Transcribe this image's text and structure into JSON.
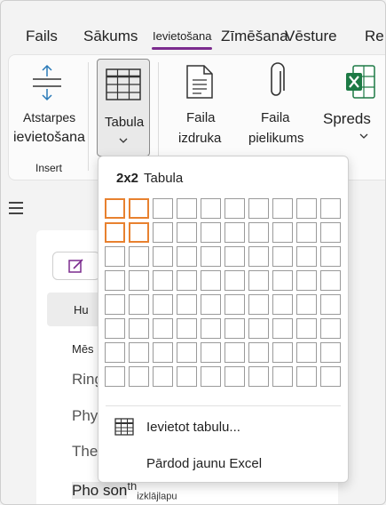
{
  "tabs": [
    {
      "label": "Fails"
    },
    {
      "label": "Sākums"
    },
    {
      "label": "Ievietošana"
    },
    {
      "label": "Zīmēšana"
    },
    {
      "label": "Vēsture"
    },
    {
      "label": "Re"
    }
  ],
  "ribbon": {
    "spacing": {
      "line1": "Atstarpes",
      "line2": "ievietošana"
    },
    "group_label": "Insert",
    "table": {
      "label": "Tabula"
    },
    "printout": {
      "line1": "Faila",
      "line2": "izdruka"
    },
    "attachment": {
      "line1": "Faila",
      "line2": "pielikums"
    },
    "spreadsheet": {
      "label": "Spreds"
    }
  },
  "left_pane": {
    "selected_row": "Hu",
    "items": [
      "Mēs",
      "Ring",
      "Phy",
      "The"
    ],
    "bottom_text": "Pho son",
    "bottom_sup": "th",
    "bottom_sub": "izklājlapu"
  },
  "dropdown": {
    "size_text": "2x2",
    "title": "Tabula",
    "grid": {
      "rows": 8,
      "cols": 10,
      "selected_rows": 2,
      "selected_cols": 2
    },
    "insert_table": "Ievietot tabulu...",
    "new_excel": "Pārdod jaunu Excel"
  },
  "colors": {
    "accent": "#7b2b8e",
    "selection": "#e8812f",
    "excel_green": "#1d7a45",
    "spacing_blue": "#2a7ab8"
  }
}
